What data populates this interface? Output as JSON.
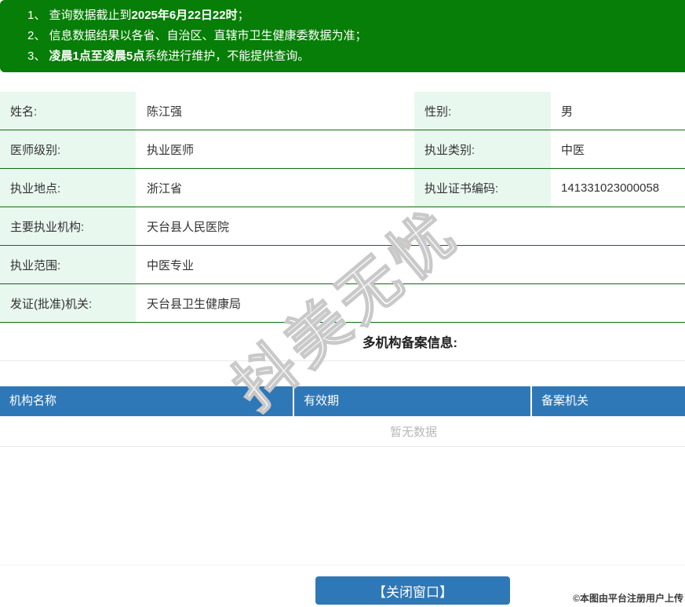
{
  "colors": {
    "banner-green": "#077e07",
    "row-line-green": "#0e6e0e",
    "label-mint": "#e9f8ef",
    "header-blue": "#2f78b7",
    "text-dark": "#333333",
    "muted-gray": "#b8b8b8",
    "line-gray": "#e8e8e8",
    "faint-gray": "#f0f0f0",
    "watermark-stroke": "#c9c9c9"
  },
  "notice": {
    "lines": [
      {
        "pre": "1、 查询数据截止到",
        "bold": "2025年6月22日22时",
        "post": "；"
      },
      {
        "pre": "2、 信息数据结果以各省、自治区、直辖市卫生健康委数据为准；",
        "bold": "",
        "post": ""
      },
      {
        "pre": "3、 ",
        "bold": "凌晨1点至凌晨5点",
        "post": "系统进行维护，不能提供查询。"
      }
    ]
  },
  "info": {
    "rows": [
      {
        "label": "姓名:",
        "value": "陈江强",
        "label2": "性别:",
        "value2": "男"
      },
      {
        "label": "医师级别:",
        "value": "执业医师",
        "label2": "执业类别:",
        "value2": "中医"
      },
      {
        "label": "执业地点:",
        "value": "浙江省",
        "label2": "执业证书编码:",
        "value2": "141331023000058"
      },
      {
        "label": "主要执业机构:",
        "value": "天台县人民医院"
      },
      {
        "label": "执业范围:",
        "value": "中医专业"
      },
      {
        "label": "发证(批准)机关:",
        "value": "天台县卫生健康局"
      }
    ],
    "section_title": "多机构备案信息:"
  },
  "filing_table": {
    "headers": [
      "机构名称",
      "有效期",
      "备案机关"
    ],
    "empty_text": "暂无数据"
  },
  "close_button_label": "【关闭窗口】",
  "watermark_text": "抖美无忧",
  "footer_stamp": "©本图由平台注册用户上传"
}
